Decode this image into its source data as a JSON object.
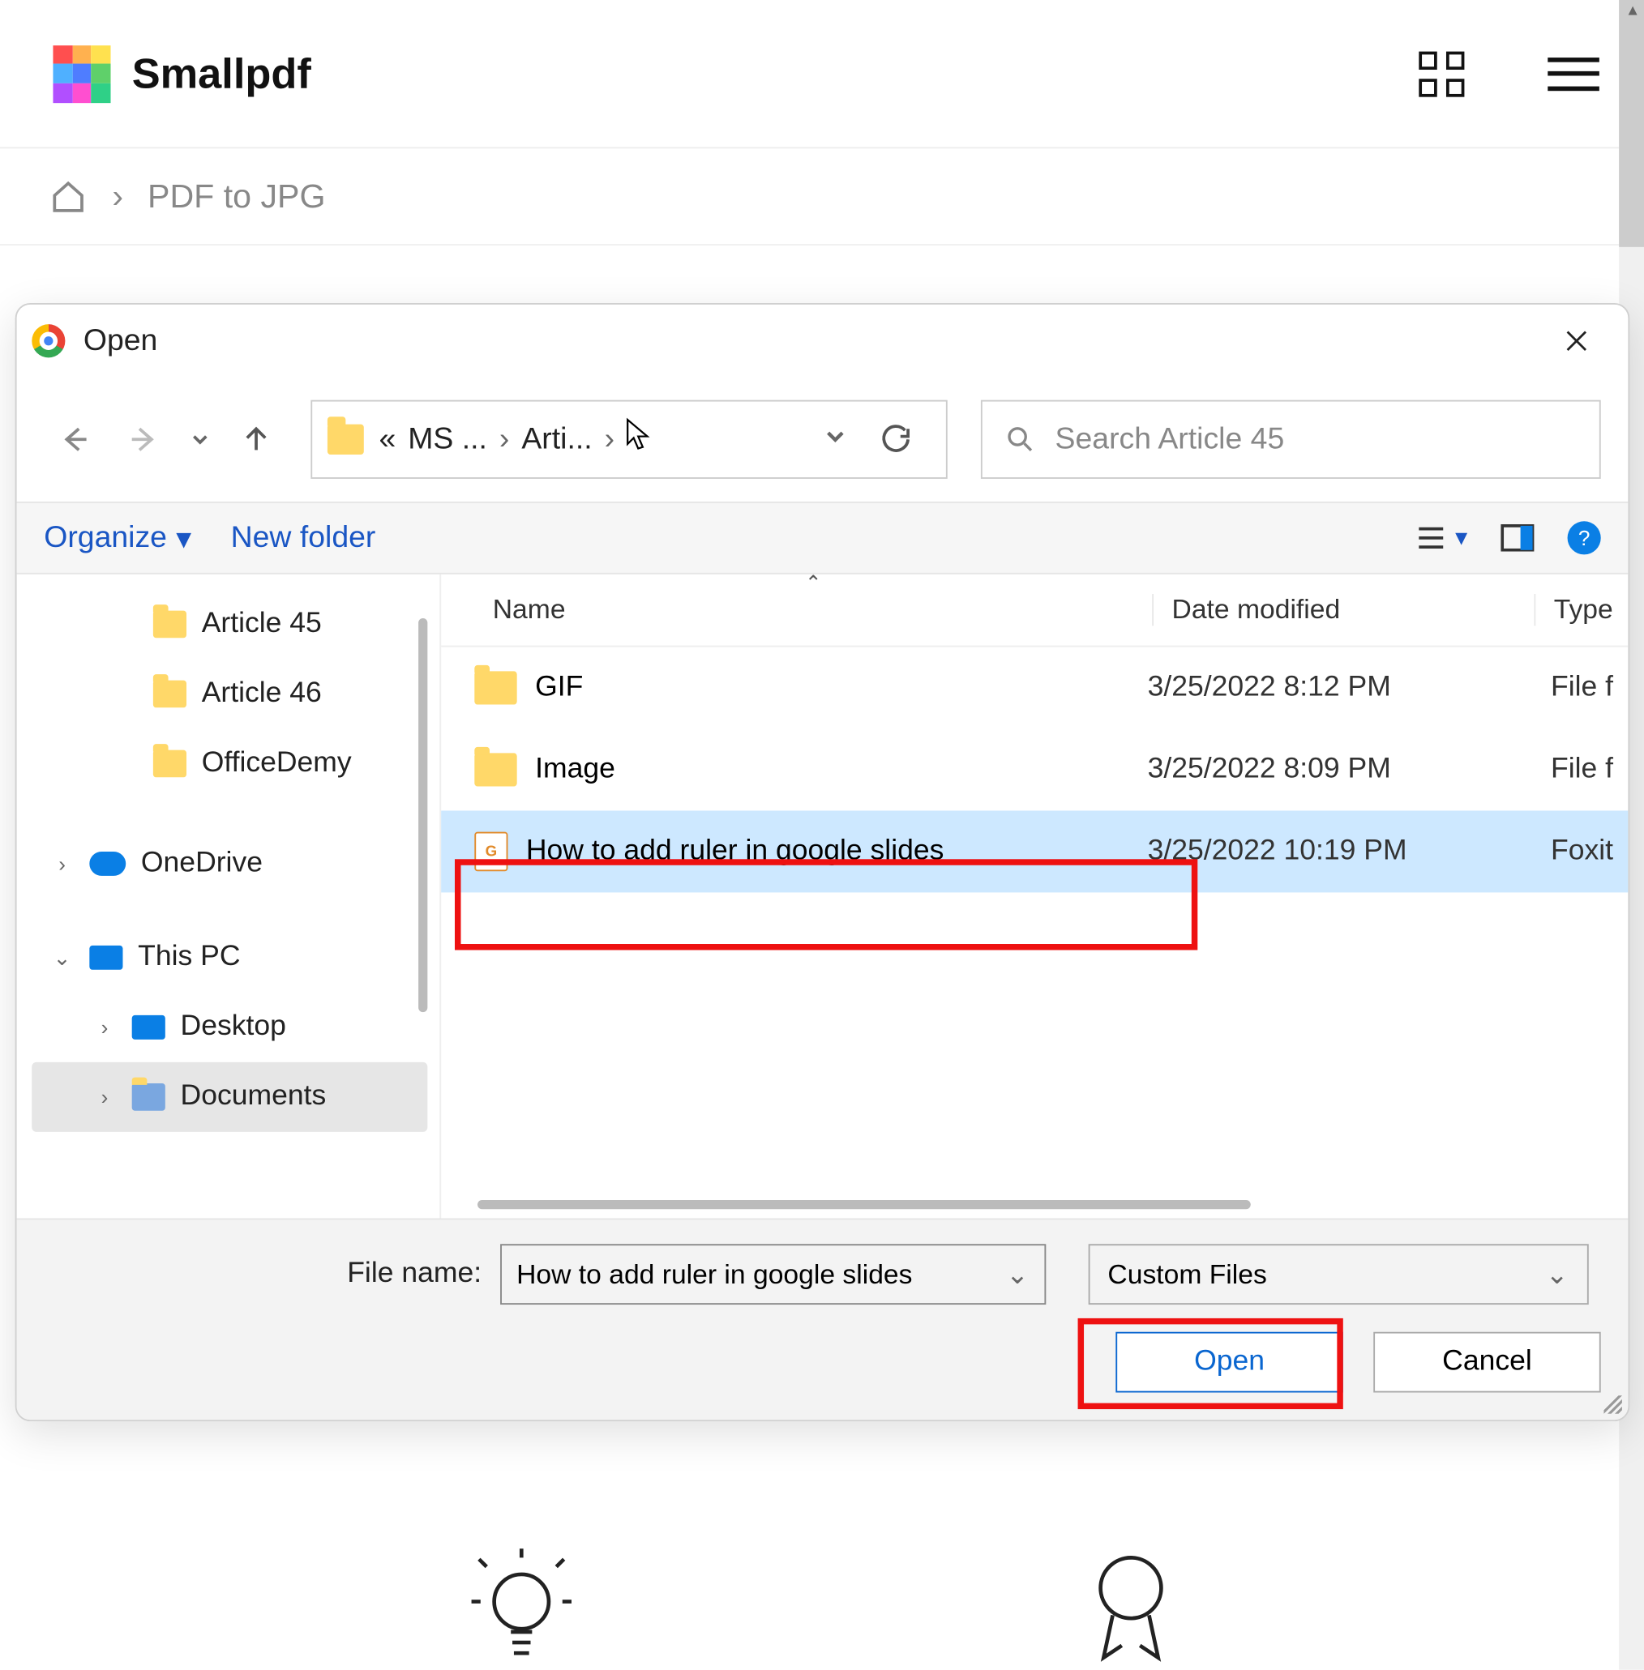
{
  "header": {
    "brand": "Smallpdf",
    "breadcrumb": "PDF to JPG"
  },
  "dialog": {
    "title": "Open",
    "path": {
      "seg1": "MS ...",
      "seg2": "Arti..."
    },
    "search_placeholder": "Search Article 45",
    "organize": "Organize",
    "new_folder": "New folder",
    "columns": {
      "name": "Name",
      "date": "Date modified",
      "type": "Type"
    },
    "tree": {
      "a45": "Article 45",
      "a46": "Article 46",
      "od_folder": "OfficeDemy",
      "onedrive": "OneDrive",
      "thispc": "This PC",
      "desktop": "Desktop",
      "documents": "Documents"
    },
    "rows": [
      {
        "name": "GIF",
        "date": "3/25/2022 8:12 PM",
        "type": "File f"
      },
      {
        "name": "Image",
        "date": "3/25/2022 8:09 PM",
        "type": "File f"
      },
      {
        "name": "How to add ruler in google slides",
        "date": "3/25/2022 10:19 PM",
        "type": "Foxit"
      }
    ],
    "filename_label": "File name:",
    "filename_value": "How to add ruler in google slides",
    "filter": "Custom Files",
    "open": "Open",
    "cancel": "Cancel"
  }
}
